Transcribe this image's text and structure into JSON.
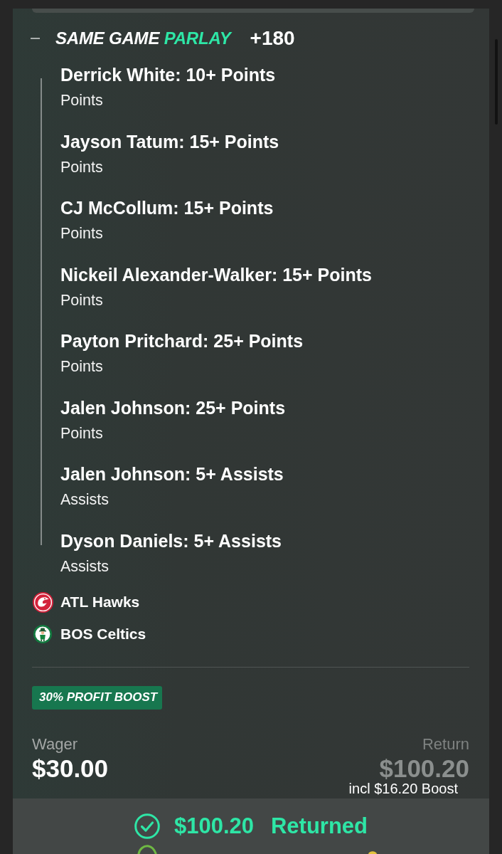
{
  "parlay": {
    "expanded": true,
    "title_parts": [
      {
        "text": "SAME GAME",
        "accent": false
      },
      {
        "text": "PARLAY",
        "accent": true
      }
    ],
    "odds": "+180",
    "legs": [
      {
        "selection": "Derrick White: 10+ Points",
        "market": "Points"
      },
      {
        "selection": "Jayson Tatum: 15+ Points",
        "market": "Points"
      },
      {
        "selection": "CJ McCollum: 15+ Points",
        "market": "Points"
      },
      {
        "selection": "Nickeil Alexander-Walker: 15+ Points",
        "market": "Points"
      },
      {
        "selection": "Payton Pritchard: 25+ Points",
        "market": "Points"
      },
      {
        "selection": "Jalen Johnson: 25+ Points",
        "market": "Points"
      },
      {
        "selection": "Jalen Johnson: 5+ Assists",
        "market": "Assists"
      },
      {
        "selection": "Dyson Daniels: 5+ Assists",
        "market": "Assists"
      }
    ],
    "teams": [
      {
        "name": "ATL Hawks",
        "kind": "hawk"
      },
      {
        "name": "BOS Celtics",
        "kind": "leprechaun"
      }
    ]
  },
  "boost": {
    "label": "30% PROFIT BOOST"
  },
  "wager": {
    "label": "Wager",
    "amount": "$30.00"
  },
  "return": {
    "label": "Return",
    "amount": "$100.20",
    "note": "incl $16.20 Boost"
  },
  "result": {
    "amount": "$100.20",
    "status": "Returned"
  }
}
